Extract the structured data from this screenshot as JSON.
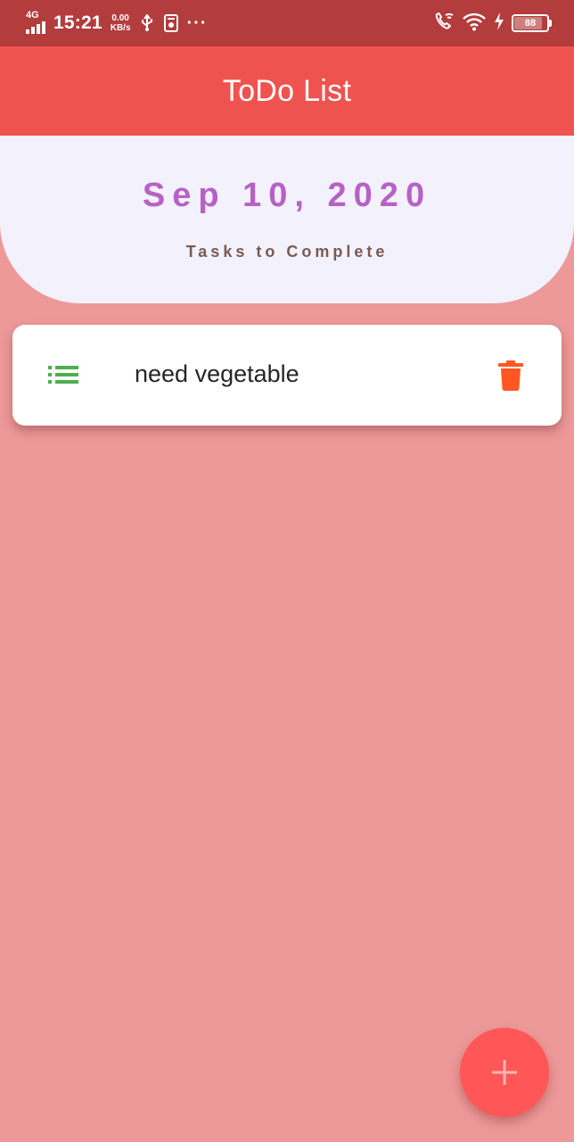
{
  "status_bar": {
    "network": "4G",
    "time": "15:21",
    "speed_value": "0.00",
    "speed_unit": "KB/s",
    "more": "···",
    "battery": "88",
    "battery_level": 0.88,
    "icons": [
      "signal-icon",
      "usb-icon",
      "notification-app-icon",
      "call-wifi-icon",
      "wifi-icon",
      "charging-icon",
      "battery-icon"
    ]
  },
  "app_bar": {
    "title": "ToDo List",
    "color": "#ef5350"
  },
  "header": {
    "date": "Sep 10, 2020",
    "subtitle": "Tasks to Complete",
    "date_color": "#b761c5",
    "subtitle_color": "#7a5a52",
    "background": "#f3f1fc"
  },
  "tasks": [
    {
      "text": "need vegetable",
      "leading_icon": "list-icon",
      "leading_icon_color": "#4caf50",
      "trailing_icon": "trash-icon",
      "trailing_icon_color": "#ff5722"
    }
  ],
  "fab": {
    "icon": "plus-icon",
    "color": "#ff5757"
  },
  "background_color": "#ee9999"
}
